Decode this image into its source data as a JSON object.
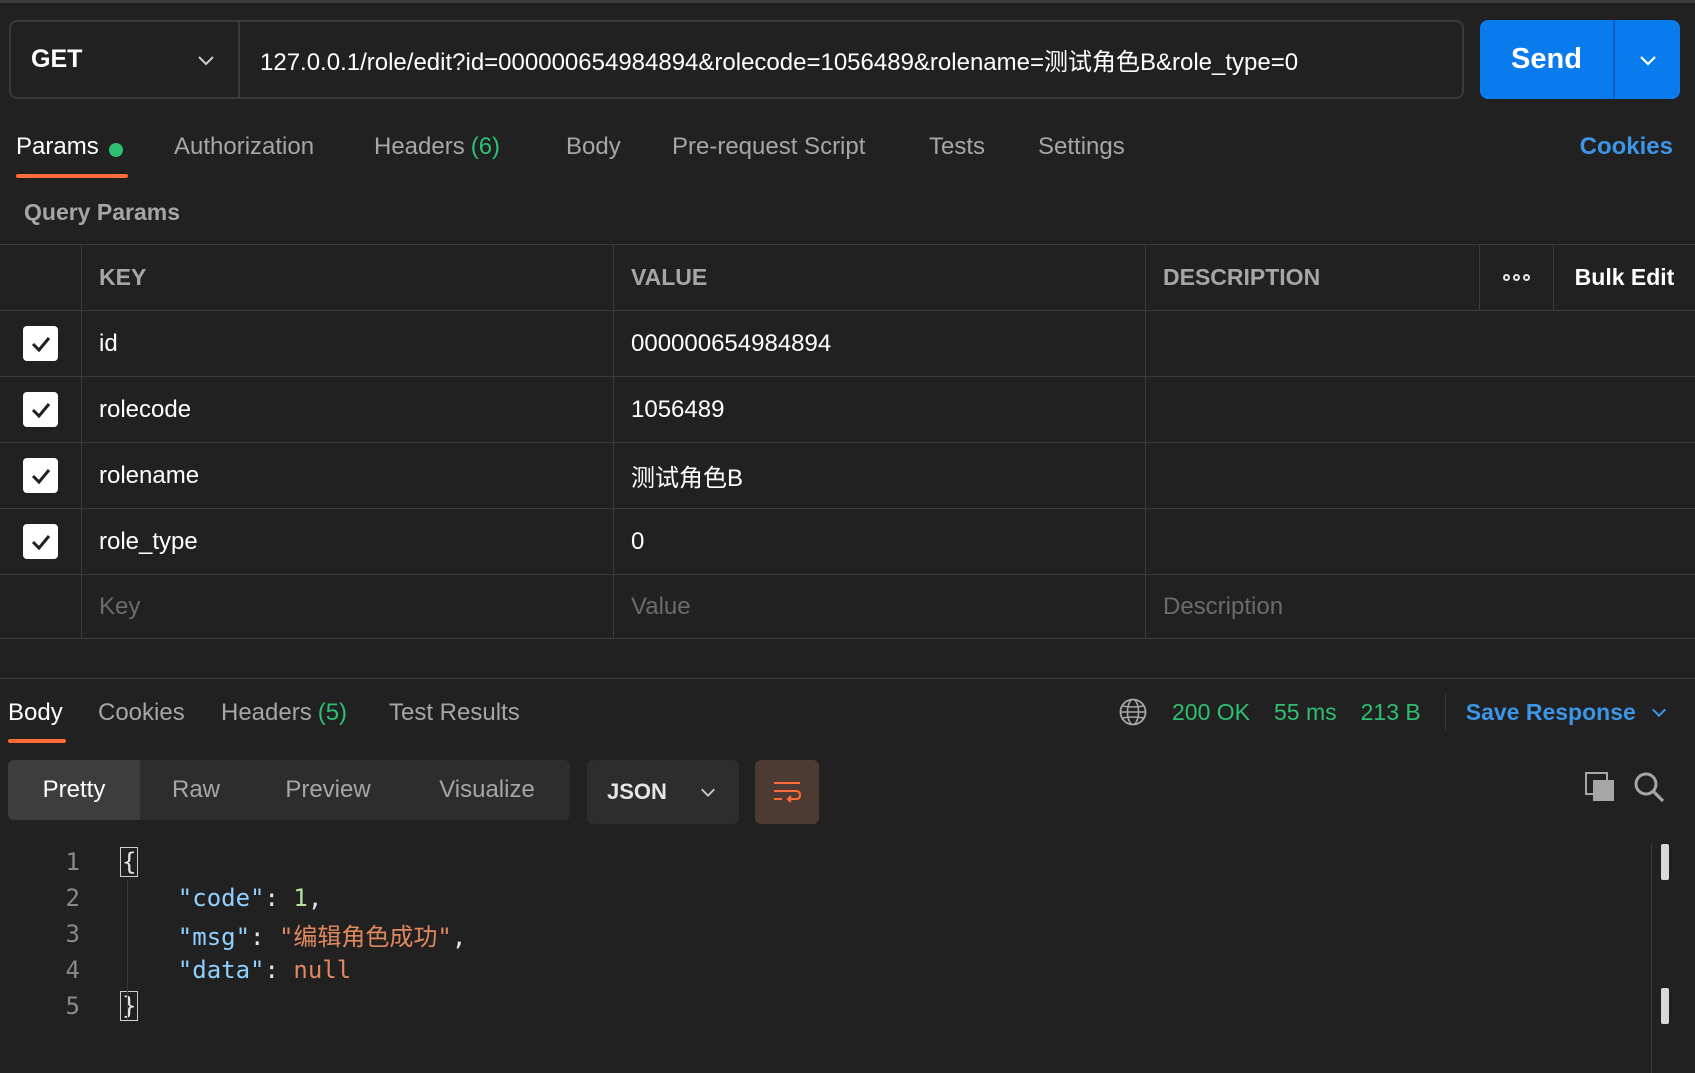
{
  "request": {
    "method": "GET",
    "url": "127.0.0.1/role/edit?id=000000654984894&rolecode=1056489&rolename=测试角色B&role_type=0",
    "send_label": "Send"
  },
  "req_tabs": {
    "params": "Params",
    "authorization": "Authorization",
    "headers": "Headers",
    "headers_count": "(6)",
    "body": "Body",
    "prerequest": "Pre-request Script",
    "tests": "Tests",
    "settings": "Settings",
    "cookies": "Cookies"
  },
  "query_params": {
    "title": "Query Params",
    "columns": {
      "key": "KEY",
      "value": "VALUE",
      "description": "DESCRIPTION",
      "bulk_edit": "Bulk Edit"
    },
    "rows": [
      {
        "key": "id",
        "value": "000000654984894",
        "checked": true
      },
      {
        "key": "rolecode",
        "value": "1056489",
        "checked": true
      },
      {
        "key": "rolename",
        "value": "测试角色B",
        "checked": true
      },
      {
        "key": "role_type",
        "value": "0",
        "checked": true
      }
    ],
    "placeholders": {
      "key": "Key",
      "value": "Value",
      "description": "Description"
    }
  },
  "response": {
    "tabs": {
      "body": "Body",
      "cookies": "Cookies",
      "headers": "Headers",
      "headers_count": "(5)",
      "test_results": "Test Results"
    },
    "status": "200 OK",
    "time": "55 ms",
    "size": "213 B",
    "save_label": "Save Response",
    "views": {
      "pretty": "Pretty",
      "raw": "Raw",
      "preview": "Preview",
      "visualize": "Visualize"
    },
    "format": "JSON",
    "code": {
      "line_numbers": [
        "1",
        "2",
        "3",
        "4",
        "5"
      ],
      "open_brace": "{",
      "close_brace": "}",
      "k_code": "\"code\"",
      "v_code": "1",
      "k_msg": "\"msg\"",
      "v_msg": "\"编辑角色成功\"",
      "k_data": "\"data\"",
      "v_data": "null"
    }
  },
  "colors": {
    "background": "#212121",
    "accent_orange": "#ff6c37",
    "send_blue": "#097bed",
    "link_blue": "#3d95e8",
    "status_green": "#2fbf71"
  }
}
